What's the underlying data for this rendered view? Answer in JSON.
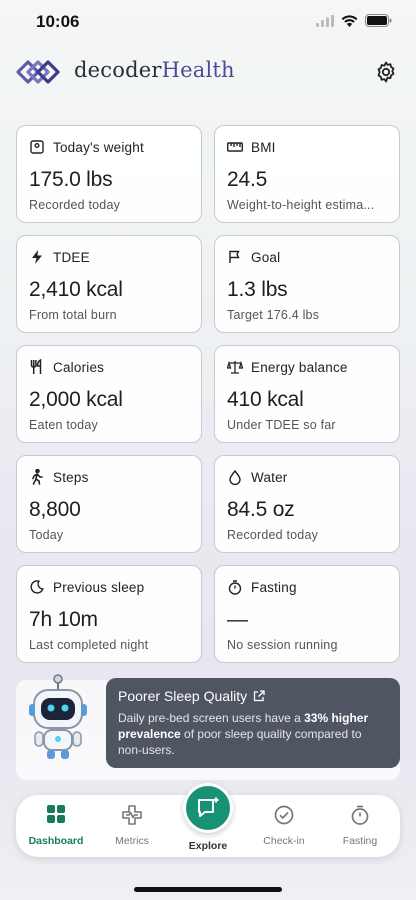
{
  "status_bar": {
    "time": "10:06"
  },
  "header": {
    "brand_part1": "decoder",
    "brand_part2": "Health"
  },
  "cards": [
    {
      "icon": "scale-icon",
      "title": "Today's weight",
      "value": "175.0 lbs",
      "sub": "Recorded today"
    },
    {
      "icon": "ruler-icon",
      "title": "BMI",
      "value": "24.5",
      "sub": "Weight-to-height estima..."
    },
    {
      "icon": "bolt-icon",
      "title": "TDEE",
      "value": "2,410 kcal",
      "sub": "From total burn"
    },
    {
      "icon": "flag-icon",
      "title": "Goal",
      "value": "1.3 lbs",
      "sub": "Target 176.4 lbs"
    },
    {
      "icon": "utensils-icon",
      "title": "Calories",
      "value": "2,000 kcal",
      "sub": "Eaten today"
    },
    {
      "icon": "balance-icon",
      "title": "Energy balance",
      "value": "410 kcal",
      "sub": "Under TDEE so far"
    },
    {
      "icon": "walking-icon",
      "title": "Steps",
      "value": "8,800",
      "sub": "Today"
    },
    {
      "icon": "droplet-icon",
      "title": "Water",
      "value": "84.5 oz",
      "sub": "Recorded today"
    },
    {
      "icon": "moon-icon",
      "title": "Previous sleep",
      "value": "7h 10m",
      "sub": "Last completed night"
    },
    {
      "icon": "stopwatch-icon",
      "title": "Fasting",
      "value": "—",
      "sub": "No session running"
    }
  ],
  "insight": {
    "title": "Poorer Sleep Quality",
    "body_pre": "Daily pre-bed screen users have a ",
    "body_bold": "33% higher prevalence",
    "body_post": " of poor sleep quality compared to non-users."
  },
  "tabs": [
    {
      "label": "Dashboard",
      "icon": "grid-icon",
      "active": true
    },
    {
      "label": "Metrics",
      "icon": "medical-cross-icon",
      "active": false
    },
    {
      "label": "Explore",
      "icon": "chat-sparkle-icon",
      "active": false
    },
    {
      "label": "Check-in",
      "icon": "check-circle-icon",
      "active": false
    },
    {
      "label": "Fasting",
      "icon": "stopwatch-icon",
      "active": false
    }
  ],
  "colors": {
    "accent": "#189274",
    "brand": "#4b4b9a",
    "tooltip": "#4f5662"
  }
}
